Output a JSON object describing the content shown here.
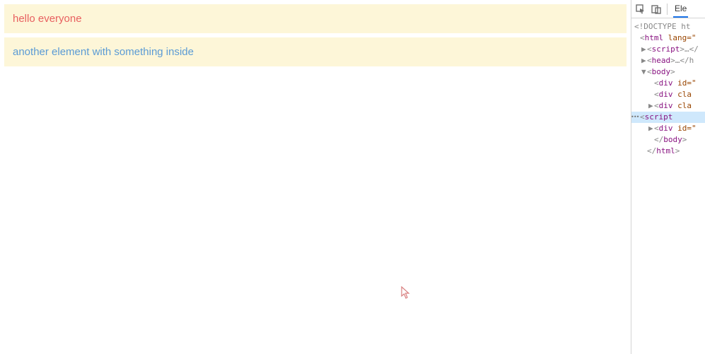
{
  "page": {
    "block1": "hello everyone",
    "block2": "another element with something inside"
  },
  "devtools": {
    "tab_label": "Ele",
    "lines": [
      {
        "indent": 0,
        "twisty": "",
        "prefix": "",
        "text": "<!DOCTYPE ht",
        "selected": false,
        "raw": true
      },
      {
        "indent": 0,
        "twisty": "",
        "prefix": "<",
        "tag": "html",
        "attr": " lang=\"",
        "suffix": "",
        "selected": false
      },
      {
        "indent": 1,
        "twisty": "▶",
        "prefix": "<",
        "tag": "script",
        "attr": "",
        "suffix": ">…</",
        "selected": false
      },
      {
        "indent": 1,
        "twisty": "▶",
        "prefix": "<",
        "tag": "head",
        "attr": "",
        "suffix": ">…</h",
        "selected": false
      },
      {
        "indent": 1,
        "twisty": "▼",
        "prefix": "<",
        "tag": "body",
        "attr": "",
        "suffix": ">",
        "selected": false
      },
      {
        "indent": 2,
        "twisty": "",
        "prefix": "<",
        "tag": "div",
        "attr": " id=\"",
        "suffix": "",
        "selected": false
      },
      {
        "indent": 2,
        "twisty": "",
        "prefix": "<",
        "tag": "div",
        "attr": " cla",
        "suffix": "",
        "selected": false
      },
      {
        "indent": 2,
        "twisty": "▶",
        "prefix": "<",
        "tag": "div",
        "attr": " cla",
        "suffix": "",
        "selected": false
      },
      {
        "indent": 2,
        "twisty": "",
        "prefix": "<",
        "tag": "script",
        "attr": " ",
        "suffix": "",
        "selected": true
      },
      {
        "indent": 2,
        "twisty": "▶",
        "prefix": "<",
        "tag": "div",
        "attr": " id=\"",
        "suffix": "",
        "selected": false
      },
      {
        "indent": 2,
        "twisty": "",
        "prefix": "</",
        "tag": "body",
        "attr": "",
        "suffix": ">",
        "selected": false
      },
      {
        "indent": 1,
        "twisty": "",
        "prefix": "</",
        "tag": "html",
        "attr": "",
        "suffix": ">",
        "selected": false
      }
    ]
  }
}
